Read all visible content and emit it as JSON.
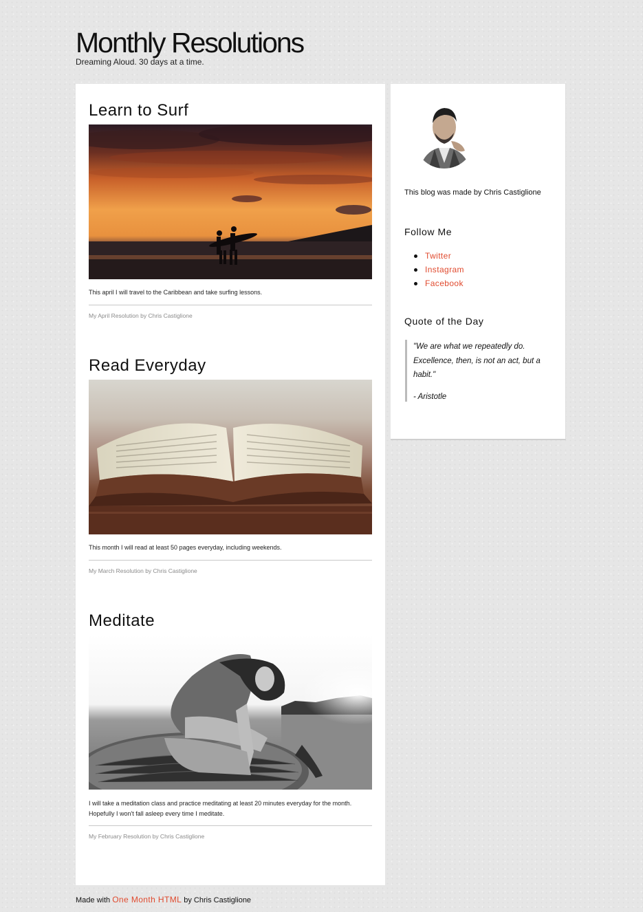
{
  "header": {
    "title": "Monthly Resolutions",
    "tagline": "Dreaming Aloud. 30 days at a time."
  },
  "posts": [
    {
      "title": "Learn to Surf",
      "image": "surfing-sunset-photo",
      "text": "This april I will travel to the Caribbean and take surfing lessons.",
      "meta": "My April Resolution by Chris Castiglione"
    },
    {
      "title": "Read Everyday",
      "image": "open-book-photo",
      "text": "This month I will read at least 50 pages everyday, including weekends.",
      "meta": "My March Resolution by Chris Castiglione"
    },
    {
      "title": "Meditate",
      "image": "woman-on-hay-bale-photo",
      "text": "I will take a meditation class and practice meditating at least 20 minutes everyday for the month. Hopefully I won't fall asleep every time I meditate.",
      "meta": "My February Resolution by Chris Castiglione"
    }
  ],
  "sidebar": {
    "avatar": "author-portrait-photo",
    "about": "This blog was made by Chris Castiglione",
    "follow_heading": "Follow Me",
    "follow_links": [
      "Twitter",
      "Instagram",
      "Facebook"
    ],
    "quote_heading": "Quote of the Day",
    "quote_text": "\"We are what we repeatedly do. Excellence, then, is not an act, but a habit.\"",
    "quote_author": "- Aristotle"
  },
  "footer": {
    "prefix": "Made with",
    "link": "One Month HTML",
    "suffix": "by Chris Castiglione"
  },
  "colors": {
    "link": "#e04a2e",
    "page_background": "#e6e6e6",
    "card_background": "#ffffff"
  }
}
